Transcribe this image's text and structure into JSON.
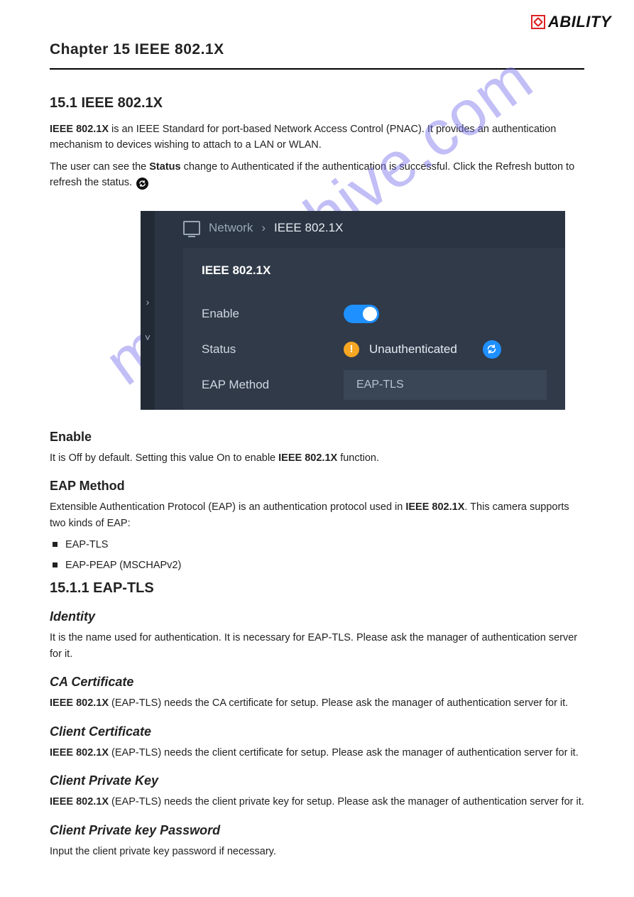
{
  "logo_text": "ABILITY",
  "watermark": "manualshive.com",
  "chapter_title": "Chapter 15 IEEE 802.1X",
  "section_title": "15.1 IEEE 802.1X",
  "intro_paragraphs": [
    {
      "pre": "",
      "hl": "IEEE 802.1X",
      "post": " is an IEEE Standard for port-based Network Access Control (PNAC). It provides an authentication mechanism to devices wishing to attach to a LAN or WLAN."
    },
    {
      "pre": "The user can see the ",
      "hl": "Status",
      "post": " change to Authenticated if the authentication is successful. Click the Refresh button  to refresh the status."
    }
  ],
  "refresh_inline_icon": "refresh-icon",
  "screenshot": {
    "breadcrumb_root": "Network",
    "breadcrumb_sep": "›",
    "breadcrumb_leaf": "IEEE 802.1X",
    "panel_title": "IEEE 802.1X",
    "rows": {
      "enable_label": "Enable",
      "status_label": "Status",
      "status_value": "Unauthenticated",
      "eap_label": "EAP Method",
      "eap_value": "EAP-TLS"
    },
    "side_chevrons": [
      "›",
      "˅"
    ]
  },
  "enable_section": {
    "heading": "Enable",
    "body_pre": "It is Off by default. Setting this value On to enable ",
    "body_hl": "IEEE 802.1X",
    "body_post": " function."
  },
  "eap_section": {
    "heading": "EAP Method",
    "body_pre": "Extensible Authentication Protocol (EAP) is an authentication protocol used in ",
    "body_hl": "IEEE 802.1X",
    "body_post": ". This camera supports two kinds of EAP:",
    "methods": [
      "EAP-TLS",
      "EAP-PEAP (MSCHAPv2)"
    ]
  },
  "eaptls": {
    "heading": "15.1.1 EAP-TLS",
    "fields": {
      "identity": {
        "heading": "Identity",
        "body": "It is the name used for authentication. It is necessary for EAP-TLS. Please ask the manager of authentication server for it."
      },
      "ca": {
        "heading": "CA Certificate",
        "body_pre": "",
        "body_hl": "IEEE 802.1X",
        "body_post": " (EAP-TLS) needs the CA certificate for setup. Please ask the manager of authentication server for it."
      },
      "client_cert": {
        "heading": "Client Certificate",
        "body_pre": "",
        "body_hl": "IEEE 802.1X",
        "body_post": " (EAP-TLS) needs the client certificate for setup. Please ask the manager of authentication server for it."
      },
      "client_key": {
        "heading": "Client Private Key",
        "body_pre": "",
        "body_hl": "IEEE 802.1X",
        "body_post": " (EAP-TLS) needs the client private key for setup. Please ask the manager of authentication server for it."
      },
      "client_key_pw": {
        "heading": "Client Private key Password",
        "body": "Input the client private key password if necessary."
      }
    }
  }
}
